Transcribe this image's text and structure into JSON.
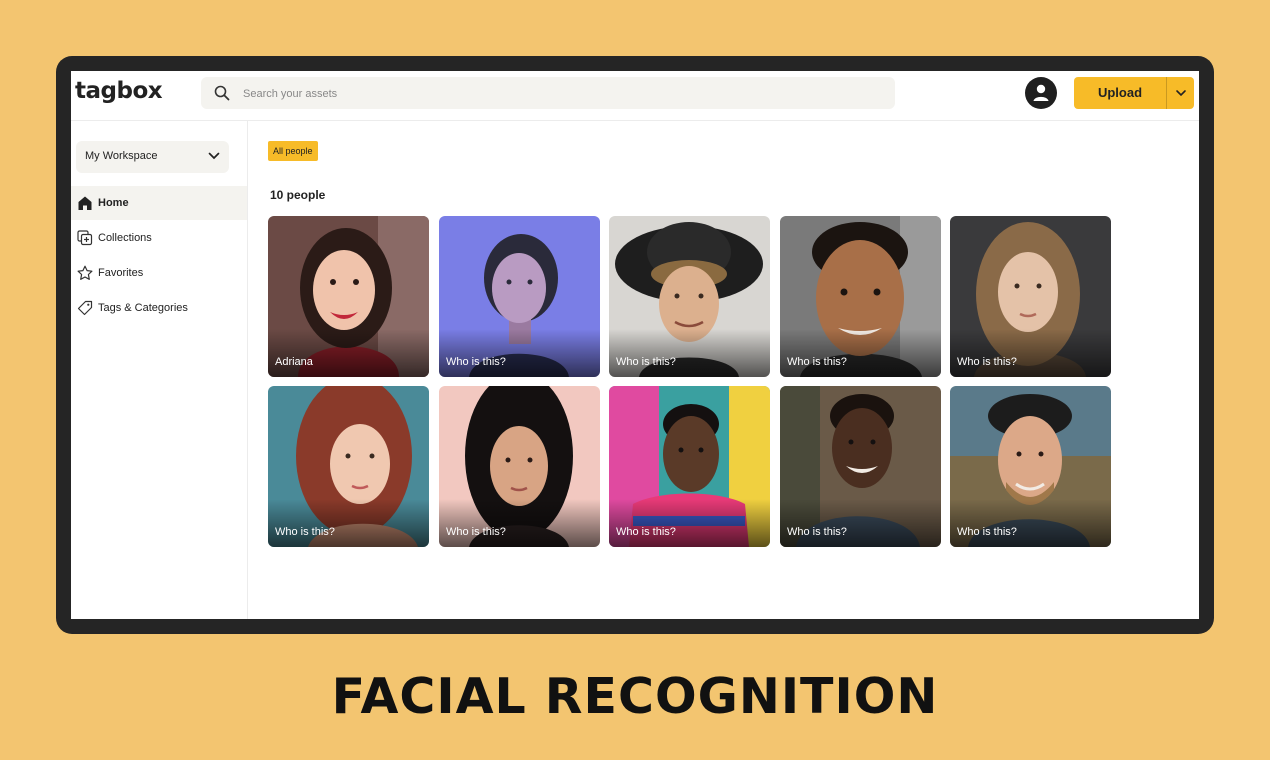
{
  "app": {
    "logo": "tagbox"
  },
  "search": {
    "placeholder": "Search your assets",
    "icon": "search-icon"
  },
  "header": {
    "upload_label": "Upload",
    "avatar_icon": "user-icon",
    "upload_menu_icon": "chevron-down-icon"
  },
  "sidebar": {
    "workspace": "My Workspace",
    "items": [
      {
        "label": "Home",
        "icon": "home-icon",
        "active": true
      },
      {
        "label": "Collections",
        "icon": "collections-icon"
      },
      {
        "label": "Favorites",
        "icon": "star-icon"
      },
      {
        "label": "Tags & Categories",
        "icon": "tag-icon"
      }
    ]
  },
  "main": {
    "filter_chip": "All people",
    "count_label": "10 people",
    "people": [
      {
        "name": "Adriana"
      },
      {
        "name": "Who is this?"
      },
      {
        "name": "Who is this?"
      },
      {
        "name": "Who is this?"
      },
      {
        "name": "Who is this?"
      },
      {
        "name": "Who is this?"
      },
      {
        "name": "Who is this?"
      },
      {
        "name": "Who is this?"
      },
      {
        "name": "Who is this?"
      },
      {
        "name": "Who is this?"
      }
    ]
  },
  "caption": "FACIAL RECOGNITION",
  "colors": {
    "background": "#F3C570",
    "accent": "#F7BB28",
    "frame": "#252525"
  }
}
